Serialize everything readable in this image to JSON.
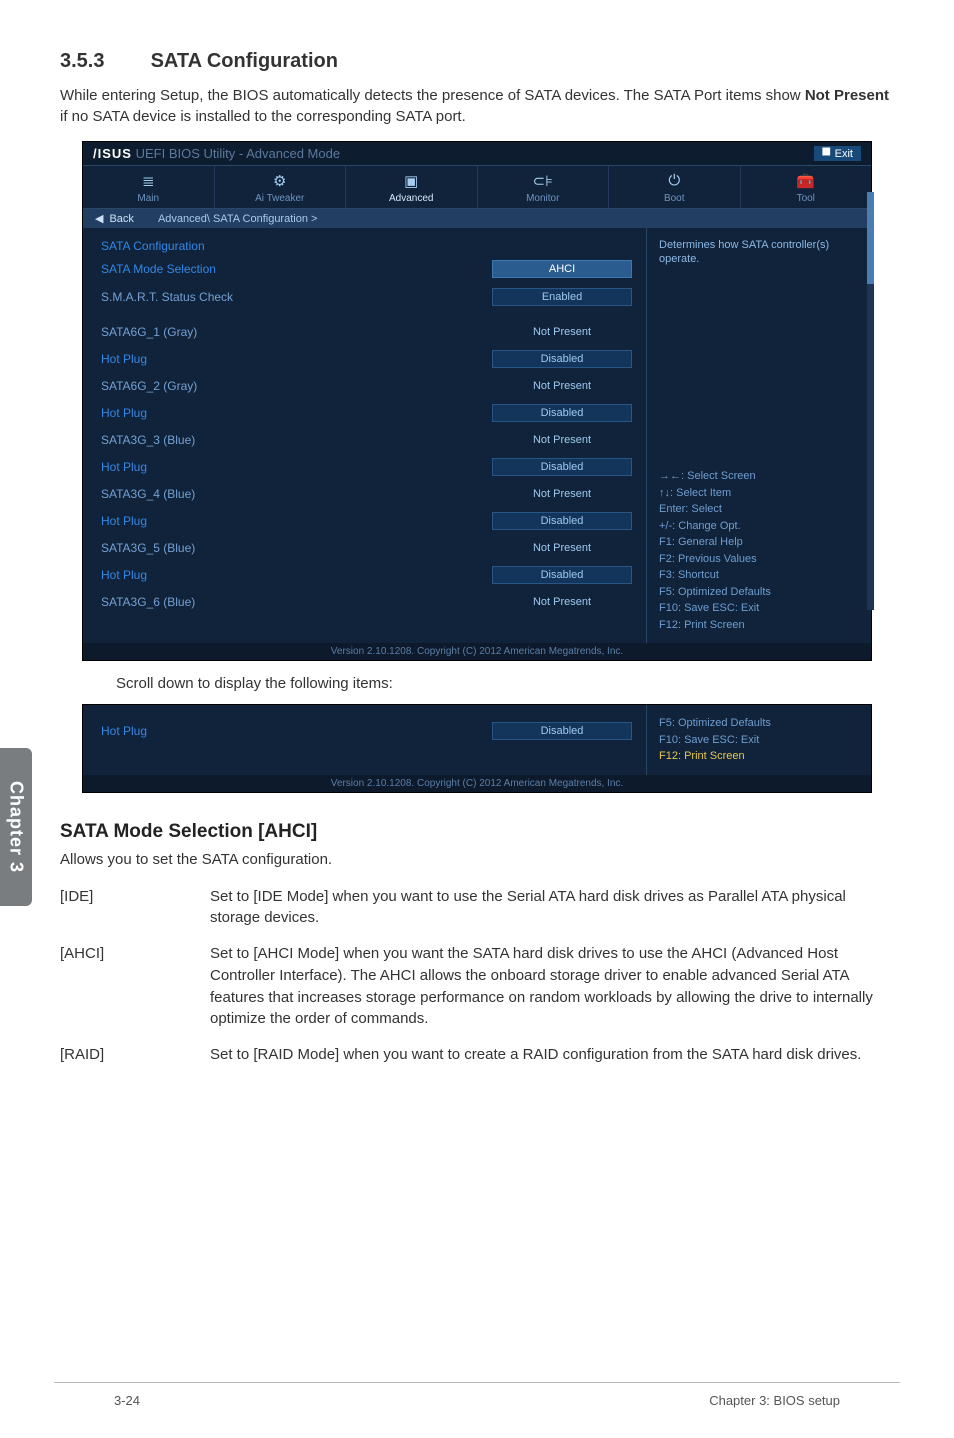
{
  "section": {
    "number": "3.5.3",
    "title": "SATA Configuration"
  },
  "intro": "While entering Setup, the BIOS automatically detects the presence of SATA devices. The SATA Port items show Not Present if no SATA device is installed to the corresponding SATA port.",
  "intro_bold": "Not Present",
  "bios_header": {
    "brand": "/ISUS",
    "product": "UEFI BIOS Utility - Advanced Mode",
    "exit": "Exit"
  },
  "tabs": [
    {
      "icon": "≣",
      "label": "Main"
    },
    {
      "icon": "⚙",
      "label": "Ai Tweaker"
    },
    {
      "icon": "▣",
      "label": "Advanced",
      "active": true
    },
    {
      "icon": "⊂⊧",
      "label": "Monitor"
    },
    {
      "icon": "⏻",
      "label": "Boot"
    },
    {
      "icon": "🧰",
      "label": "Tool"
    }
  ],
  "back": {
    "arrow": "◀",
    "label": "Back",
    "crumb": "Advanced\\ SATA Configuration >"
  },
  "help_text": "Determines how SATA controller(s) operate.",
  "rows": [
    {
      "group": true,
      "label": "SATA Configuration"
    },
    {
      "label": "SATA Mode Selection",
      "blue": true,
      "val": "AHCI",
      "hl": true
    },
    {
      "label": "S.M.A.R.T. Status Check",
      "val": "Enabled"
    },
    {
      "spacer": true
    },
    {
      "label": "SATA6G_1 (Gray)",
      "val": "Not Present",
      "plain": true
    },
    {
      "label": "Hot Plug",
      "blue": true,
      "val": "Disabled"
    },
    {
      "label": "SATA6G_2 (Gray)",
      "val": "Not Present",
      "plain": true
    },
    {
      "label": "Hot Plug",
      "blue": true,
      "val": "Disabled"
    },
    {
      "label": "SATA3G_3 (Blue)",
      "val": "Not Present",
      "plain": true
    },
    {
      "label": "Hot Plug",
      "blue": true,
      "val": "Disabled"
    },
    {
      "label": "SATA3G_4 (Blue)",
      "val": "Not Present",
      "plain": true
    },
    {
      "label": "Hot Plug",
      "blue": true,
      "val": "Disabled"
    },
    {
      "label": "SATA3G_5 (Blue)",
      "val": "Not Present",
      "plain": true
    },
    {
      "label": "Hot Plug",
      "blue": true,
      "val": "Disabled"
    },
    {
      "label": "SATA3G_6 (Blue)",
      "val": "Not Present",
      "plain": true
    }
  ],
  "nav_keys": [
    {
      "text": "→←: Select Screen"
    },
    {
      "text": "↑↓: Select Item"
    },
    {
      "text": "Enter: Select"
    },
    {
      "text": "+/-: Change Opt."
    },
    {
      "text": "F1: General Help"
    },
    {
      "text": "F2: Previous Values"
    },
    {
      "text": "F3: Shortcut"
    },
    {
      "text": "F5: Optimized Defaults"
    },
    {
      "text": "F10: Save   ESC: Exit"
    },
    {
      "text": "F12: Print Screen",
      "yellow": true
    }
  ],
  "bios_footer": "Version 2.10.1208. Copyright (C) 2012 American Megatrends, Inc.",
  "scroll_note": "Scroll down to display the following items:",
  "bios2_row": {
    "label": "Hot Plug",
    "val": "Disabled"
  },
  "bios2_keys": [
    {
      "text": "F5: Optimized Defaults"
    },
    {
      "text": "F10: Save   ESC: Exit"
    },
    {
      "text": "F12: Print Screen",
      "yellow": true
    }
  ],
  "sub_heading": "SATA Mode Selection [AHCI]",
  "sub_desc": "Allows you to set the SATA configuration.",
  "options": [
    {
      "key": "[IDE]",
      "desc": "Set to [IDE Mode] when you want to use the Serial ATA hard disk drives as Parallel ATA physical storage devices."
    },
    {
      "key": "[AHCI]",
      "desc": "Set to [AHCI Mode] when you want the SATA hard disk drives to use the AHCI (Advanced Host Controller Interface). The AHCI allows the onboard storage driver to enable advanced Serial ATA features that increases storage performance on random workloads by allowing the drive to internally optimize the order of commands."
    },
    {
      "key": "[RAID]",
      "desc": "Set to [RAID Mode] when you want to create a RAID configuration from the SATA hard disk drives."
    }
  ],
  "side_tab": "Chapter 3",
  "footer": {
    "left": "3-24",
    "right": "Chapter 3: BIOS setup"
  }
}
